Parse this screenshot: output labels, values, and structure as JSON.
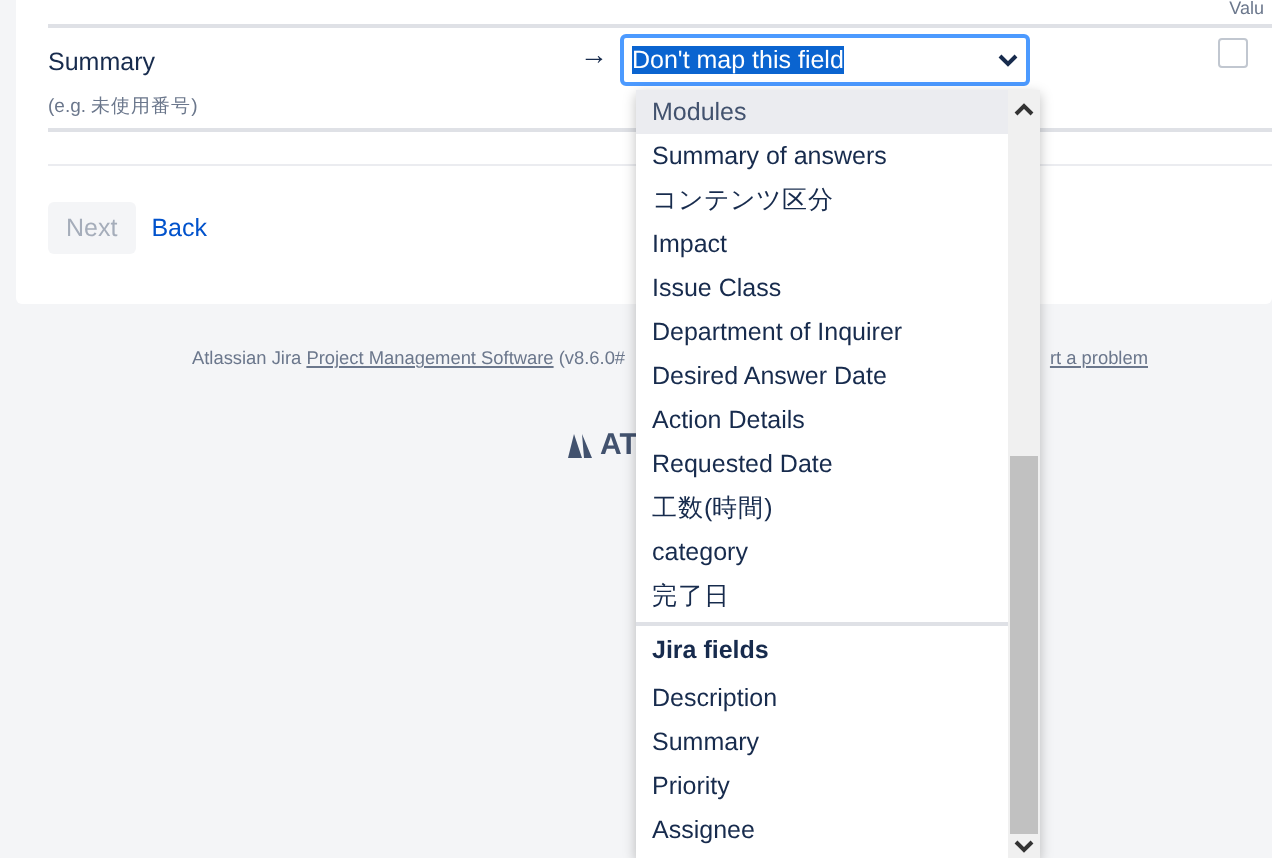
{
  "table": {
    "column_header": "Valu",
    "rows": [
      {
        "label": "Summary",
        "hint": "(e.g. 未使用番号)",
        "arrow": "→",
        "select": {
          "value": "Don't map this field",
          "expanded": true
        },
        "checked": false
      }
    ]
  },
  "buttons": [
    {
      "label": "Next",
      "disabled": true,
      "kind": "button"
    },
    {
      "label": "Back",
      "disabled": false,
      "kind": "link"
    }
  ],
  "footer": {
    "prefix": "Atlassian Jira ",
    "link": "Project Management Software",
    "version": " (v8.6.0#",
    "report_link": "rt a problem",
    "logo_text": "AT"
  },
  "dropdown": {
    "options": [
      {
        "label": "Modules",
        "kind": "option",
        "selected": true
      },
      {
        "label": "Summary of answers",
        "kind": "option",
        "selected": false
      },
      {
        "label": "コンテンツ区分",
        "kind": "option",
        "selected": false
      },
      {
        "label": "Impact",
        "kind": "option",
        "selected": false
      },
      {
        "label": "Issue Class",
        "kind": "option",
        "selected": false
      },
      {
        "label": "Department of Inquirer",
        "kind": "option",
        "selected": false
      },
      {
        "label": "Desired Answer Date",
        "kind": "option",
        "selected": false
      },
      {
        "label": "Action Details",
        "kind": "option",
        "selected": false
      },
      {
        "label": "Requested Date",
        "kind": "option",
        "selected": false
      },
      {
        "label": "工数(時間)",
        "kind": "option",
        "selected": false
      },
      {
        "label": "category",
        "kind": "option",
        "selected": false
      },
      {
        "label": "完了日",
        "kind": "option",
        "selected": false
      },
      {
        "label": "Jira fields",
        "kind": "group"
      },
      {
        "label": "Description",
        "kind": "option",
        "selected": false
      },
      {
        "label": "Summary",
        "kind": "option",
        "selected": false
      },
      {
        "label": "Priority",
        "kind": "option",
        "selected": false
      },
      {
        "label": "Assignee",
        "kind": "option",
        "selected": false
      }
    ]
  }
}
